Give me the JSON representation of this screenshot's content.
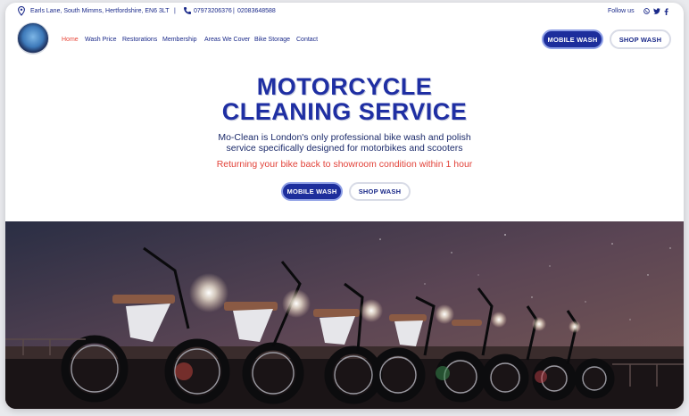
{
  "topbar": {
    "address": "Earls Lane, South Mimms, Hertfordshire, EN6 3LT",
    "separator": "|",
    "phone1": "07973206376",
    "phone_separator": "|",
    "phone2": "02083648588",
    "follow_label": "Follow us"
  },
  "nav": {
    "items": [
      {
        "label": "Home",
        "active": true
      },
      {
        "label": "Wash Price"
      },
      {
        "label": "Restorations"
      },
      {
        "label": "Membership"
      },
      {
        "label": "Areas We Cover"
      },
      {
        "label": "Bike Storage"
      },
      {
        "label": "Contact"
      }
    ],
    "cta_primary": "MOBILE WASH",
    "cta_secondary": "SHOP WASH"
  },
  "hero": {
    "title_line1": "MOTORCYCLE",
    "title_line2": "CLEANING SERVICE",
    "subtitle_line1": "Mo-Clean is London's only professional bike wash and polish",
    "subtitle_line2": "service specifically designed for motorbikes and scooters",
    "tagline": "Returning your bike back to showroom condition within 1 hour",
    "button_primary": "MOBILE WASH",
    "button_secondary": "SHOP WASH"
  },
  "colors": {
    "brand_blue": "#1f2fa3",
    "accent_red": "#e2433a"
  },
  "icons": [
    "location-pin-icon",
    "phone-icon",
    "whatsapp-icon",
    "twitter-icon",
    "facebook-icon"
  ]
}
